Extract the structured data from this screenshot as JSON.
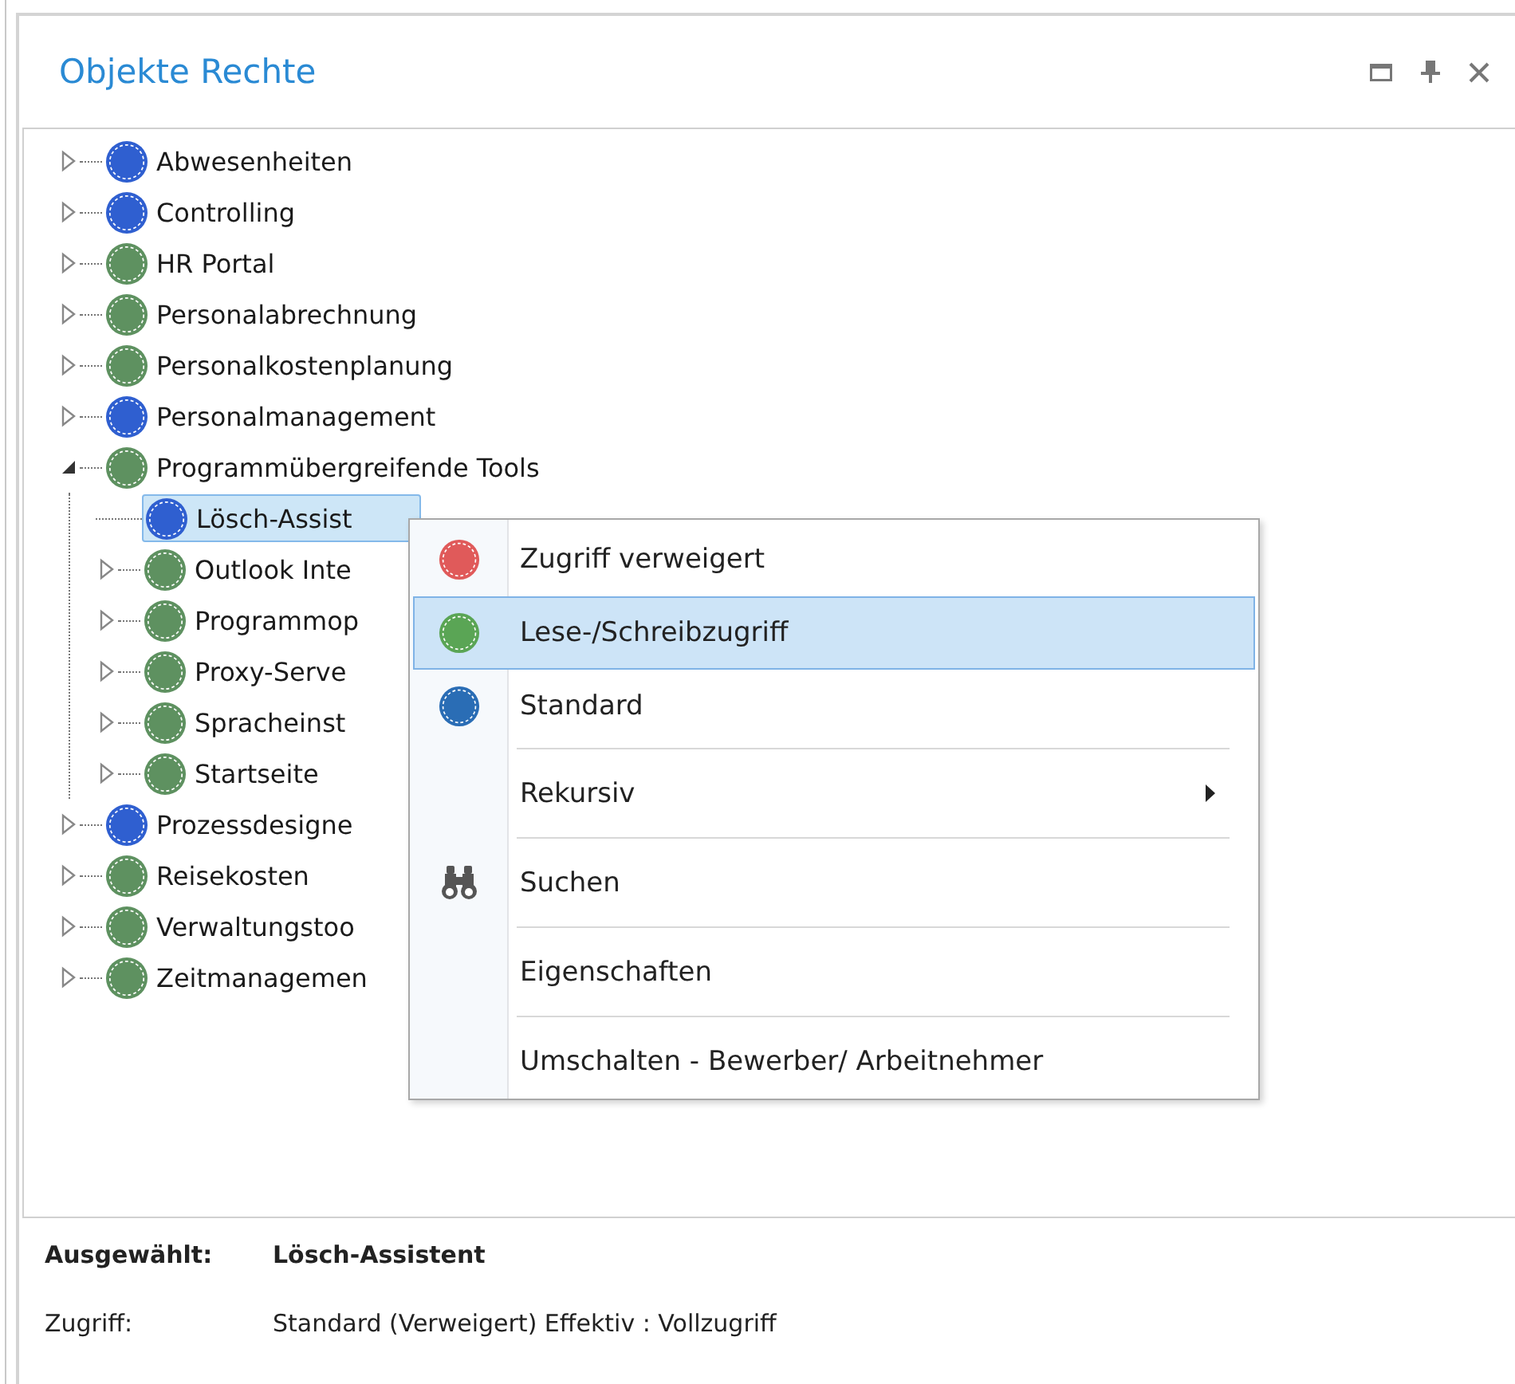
{
  "panel": {
    "title": "Objekte Rechte"
  },
  "tree": [
    {
      "label": "Abwesenheiten",
      "color": "#2f5fd0",
      "expanded": false,
      "selected": false
    },
    {
      "label": "Controlling",
      "color": "#2f5fd0",
      "expanded": false,
      "selected": false
    },
    {
      "label": "HR Portal",
      "color": "#5e9160",
      "expanded": false,
      "selected": false
    },
    {
      "label": "Personalabrechnung",
      "color": "#5e9160",
      "expanded": false,
      "selected": false
    },
    {
      "label": "Personalkostenplanung",
      "color": "#5e9160",
      "expanded": false,
      "selected": false
    },
    {
      "label": "Personalmanagement",
      "color": "#2f5fd0",
      "expanded": false,
      "selected": false
    },
    {
      "label": "Programmübergreifende Tools",
      "color": "#5e9160",
      "expanded": true,
      "selected": false,
      "children": [
        {
          "label": "Lösch-Assist",
          "color": "#2f5fd0",
          "selected": true
        },
        {
          "label": "Outlook Inte",
          "color": "#5e9160",
          "expanded": false,
          "selected": false
        },
        {
          "label": "Programmop",
          "color": "#5e9160",
          "expanded": false,
          "selected": false
        },
        {
          "label": "Proxy-Serve",
          "color": "#5e9160",
          "expanded": false,
          "selected": false
        },
        {
          "label": "Spracheinst",
          "color": "#5e9160",
          "expanded": false,
          "selected": false
        },
        {
          "label": "Startseite",
          "color": "#5e9160",
          "expanded": false,
          "selected": false
        }
      ]
    },
    {
      "label": "Prozessdesigne",
      "color": "#2f5fd0",
      "expanded": false,
      "selected": false
    },
    {
      "label": "Reisekosten",
      "color": "#5e9160",
      "expanded": false,
      "selected": false
    },
    {
      "label": "Verwaltungstoo",
      "color": "#5e9160",
      "expanded": false,
      "selected": false
    },
    {
      "label": "Zeitmanagemen",
      "color": "#5e9160",
      "expanded": false,
      "selected": false
    }
  ],
  "context_menu": [
    [
      {
        "label": "Zugriff verweigert",
        "kind": "dot",
        "color": "#e05a5a",
        "selected": false,
        "submenu": false
      },
      {
        "label": "Lese-/Schreibzugriff",
        "kind": "dot",
        "color": "#5aa555",
        "selected": true,
        "submenu": false
      },
      {
        "label": "Standard",
        "kind": "dot",
        "color": "#2a6db5",
        "selected": false,
        "submenu": false
      }
    ],
    [
      {
        "label": "Rekursiv",
        "kind": "plain",
        "selected": false,
        "submenu": true
      }
    ],
    [
      {
        "label": "Suchen",
        "kind": "binoculars",
        "selected": false,
        "submenu": false
      }
    ],
    [
      {
        "label": "Eigenschaften",
        "kind": "plain",
        "selected": false,
        "submenu": false
      }
    ],
    [
      {
        "label": "Umschalten - Bewerber/ Arbeitnehmer",
        "kind": "plain",
        "selected": false,
        "submenu": false
      }
    ]
  ],
  "details": [
    {
      "label": "Ausgewählt:",
      "value": "Lösch-Assistent",
      "kind": "bold"
    },
    {
      "label": "Zugriff:",
      "value": "Standard (Verweigert) Effektiv : Vollzugriff",
      "kind": "plain"
    }
  ]
}
